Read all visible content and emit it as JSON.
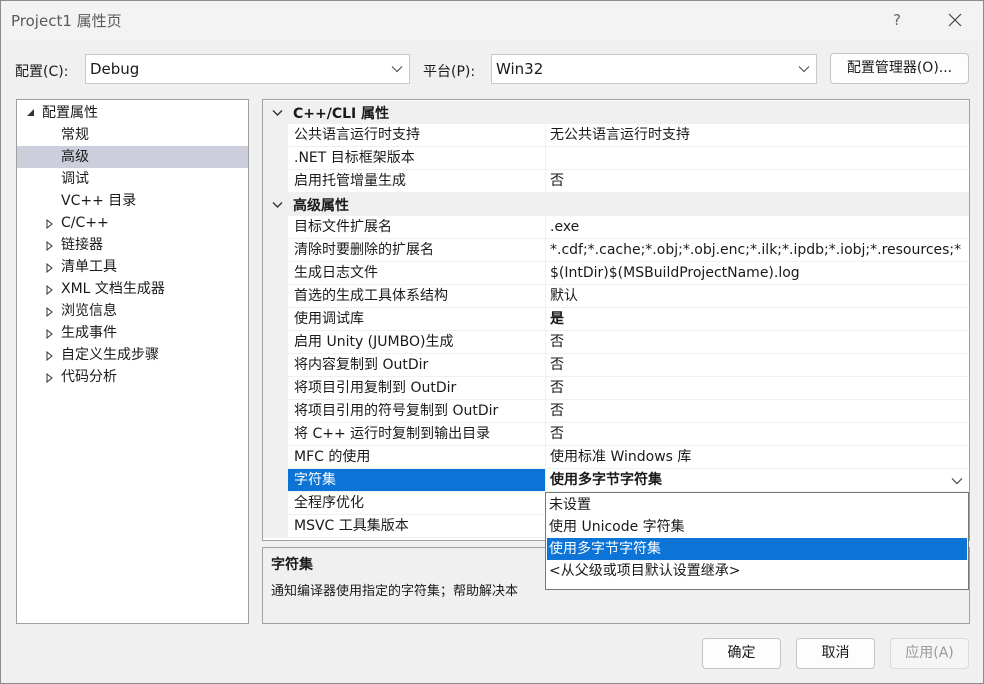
{
  "window": {
    "title": "Project1 属性页",
    "help": "?"
  },
  "toolbar": {
    "config_label": "配置(C):",
    "config_value": "Debug",
    "platform_label": "平台(P):",
    "platform_value": "Win32",
    "config_manager": "配置管理器(O)..."
  },
  "tree": {
    "root": "配置属性",
    "children": [
      "常规",
      "高级",
      "调试",
      "VC++ 目录"
    ],
    "groups": [
      "C/C++",
      "链接器",
      "清单工具",
      "XML 文档生成器",
      "浏览信息",
      "生成事件",
      "自定义生成步骤",
      "代码分析"
    ]
  },
  "grid": {
    "cat1": "C++/CLI 属性",
    "cat1_rows": [
      {
        "name": "公共语言运行时支持",
        "value": "无公共语言运行时支持"
      },
      {
        "name": ".NET 目标框架版本",
        "value": ""
      },
      {
        "name": "启用托管增量生成",
        "value": "否"
      }
    ],
    "cat2": "高级属性",
    "cat2_rows": [
      {
        "name": "目标文件扩展名",
        "value": ".exe"
      },
      {
        "name": "清除时要删除的扩展名",
        "value": "*.cdf;*.cache;*.obj;*.obj.enc;*.ilk;*.ipdb;*.iobj;*.resources;*"
      },
      {
        "name": "生成日志文件",
        "value": "$(IntDir)$(MSBuildProjectName).log"
      },
      {
        "name": "首选的生成工具体系结构",
        "value": "默认"
      },
      {
        "name": "使用调试库",
        "value": "是"
      },
      {
        "name": "启用 Unity (JUMBO)生成",
        "value": "否"
      },
      {
        "name": "将内容复制到 OutDir",
        "value": "否"
      },
      {
        "name": "将项目引用复制到 OutDir",
        "value": "否"
      },
      {
        "name": "将项目引用的符号复制到 OutDir",
        "value": "否"
      },
      {
        "name": "将 C++ 运行时复制到输出目录",
        "value": "否"
      },
      {
        "name": "MFC 的使用",
        "value": "使用标准 Windows 库"
      },
      {
        "name": "字符集",
        "value": "使用多字节字符集"
      },
      {
        "name": "全程序优化",
        "value": ""
      },
      {
        "name": "MSVC 工具集版本",
        "value": ""
      }
    ]
  },
  "dropdown": {
    "options": [
      "未设置",
      "使用 Unicode 字符集",
      "使用多字节字符集",
      "<从父级或项目默认设置继承>"
    ]
  },
  "description": {
    "title": "字符集",
    "text": "通知编译器使用指定的字符集；帮助解决本"
  },
  "buttons": {
    "ok": "确定",
    "cancel": "取消",
    "apply": "应用(A)"
  }
}
